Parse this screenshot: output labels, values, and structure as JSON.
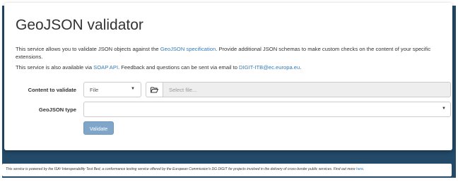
{
  "header": {
    "title": "GeoJSON validator"
  },
  "description": {
    "line1_pre": "This service allows you to validate JSON objects against the ",
    "line1_link": "GeoJSON specification",
    "line1_post": ". Provide additional JSON schemas to make custom checks on the content of your specific extensions.",
    "line2_pre": "This service is also available via ",
    "line2_link1": "SOAP API",
    "line2_mid": ". Feedback and questions can be sent via email to ",
    "line2_link2": "DIGIT-ITB@ec.europa.eu",
    "line2_post": "."
  },
  "form": {
    "content_label": "Content to validate",
    "content_type_value": "File",
    "file_placeholder": "Select file...",
    "geojson_type_label": "GeoJSON type",
    "geojson_type_value": "",
    "validate_label": "Validate"
  },
  "footer": {
    "text_pre": "This service is powered by the ISA² Interoperability Test Bed, a conformance testing service offered by the European Commission's DG DIGIT for projects involved in the delivery of cross-border public services. Find out more ",
    "link": "here",
    "text_post": "."
  },
  "colors": {
    "link": "#337ab7",
    "page_background": "#234a69",
    "button": "#7fa6c9"
  },
  "icons": {
    "file_button": "folder-open-icon",
    "dropdown": "caret-down-icon"
  }
}
